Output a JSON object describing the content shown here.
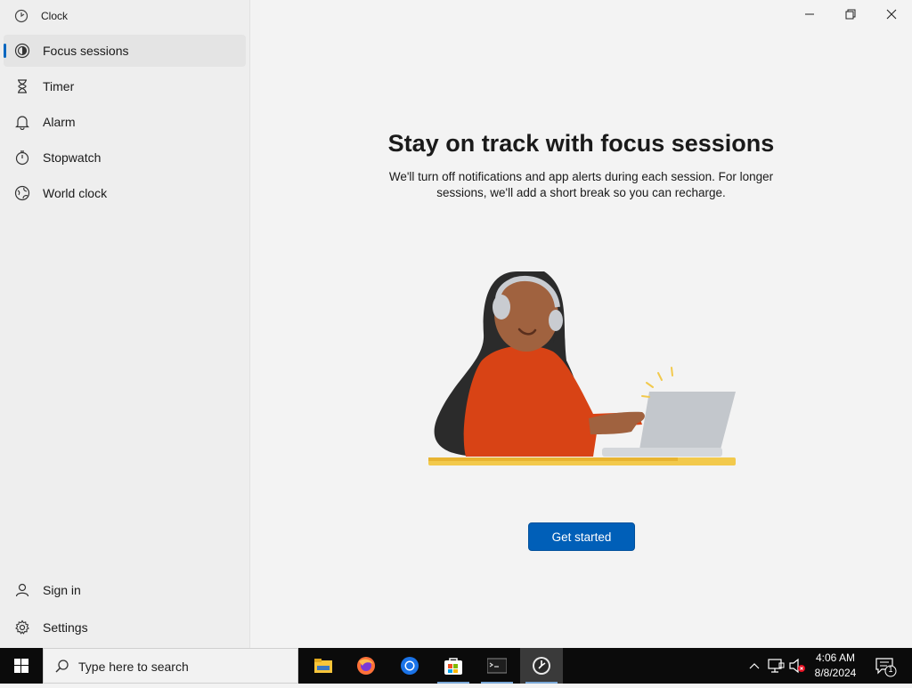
{
  "app": {
    "title": "Clock"
  },
  "sidebar": {
    "items": [
      {
        "label": "Focus sessions",
        "icon": "focus-icon",
        "selected": true
      },
      {
        "label": "Timer",
        "icon": "hourglass-icon"
      },
      {
        "label": "Alarm",
        "icon": "bell-icon"
      },
      {
        "label": "Stopwatch",
        "icon": "stopwatch-icon"
      },
      {
        "label": "World clock",
        "icon": "globe-icon"
      }
    ],
    "bottom_items": [
      {
        "label": "Sign in",
        "icon": "person-icon"
      },
      {
        "label": "Settings",
        "icon": "gear-icon"
      }
    ]
  },
  "main": {
    "title": "Stay on track with focus sessions",
    "description": "We'll turn off notifications and app alerts during each session. For longer sessions, we'll add a short break so you can recharge.",
    "button_label": "Get started"
  },
  "taskbar": {
    "search_placeholder": "Type here to search",
    "apps": [
      "file-explorer-icon",
      "firefox-icon",
      "chrome-icon",
      "store-icon",
      "terminal-icon",
      "clock-app-icon"
    ],
    "time": "4:06 AM",
    "date": "8/8/2024",
    "notification_count": "1"
  },
  "colors": {
    "accent": "#005fb8",
    "indicator": "#0067c0",
    "taskbar": "#0b0b0b"
  }
}
